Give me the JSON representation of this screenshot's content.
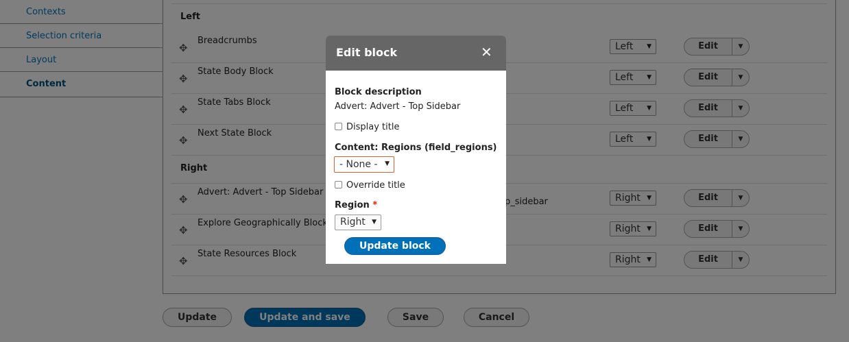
{
  "vertical_tabs": [
    {
      "label": "Contexts"
    },
    {
      "label": "Selection criteria"
    },
    {
      "label": "Layout"
    },
    {
      "label": "Content",
      "active": true
    }
  ],
  "regions": {
    "left": {
      "heading": "Left",
      "rows": [
        {
          "title": "Breadcrumbs",
          "region": "Left",
          "edit": "Edit"
        },
        {
          "title": "State Body Block",
          "region": "Left",
          "edit": "Edit"
        },
        {
          "title": "State Tabs Block",
          "region": "Left",
          "edit": "Edit"
        },
        {
          "title": "Next State Block",
          "region": "Left",
          "edit": "Edit"
        }
      ]
    },
    "right": {
      "heading": "Right",
      "rows": [
        {
          "title": "Advert: Advert - Top Sidebar",
          "extra": "op_sidebar",
          "region": "Right",
          "edit": "Edit"
        },
        {
          "title": "Explore Geographically Block",
          "region": "Right",
          "edit": "Edit"
        },
        {
          "title": "State Resources Block",
          "region": "Right",
          "edit": "Edit"
        }
      ]
    }
  },
  "footer_buttons": {
    "update": "Update",
    "update_and_save": "Update and save",
    "save": "Save",
    "cancel": "Cancel"
  },
  "dialog": {
    "title": "Edit block",
    "close_glyph": "✕",
    "block_description_label": "Block description",
    "block_description_value": "Advert: Advert - Top Sidebar",
    "display_title_label": "Display title",
    "display_title_checked": false,
    "content_regions_label": "Content: Regions (field_regions)",
    "content_regions_value": "- None -",
    "override_title_label": "Override title",
    "override_title_checked": false,
    "region_label": "Region",
    "region_required_marker": "*",
    "region_value": "Right",
    "update_button": "Update block"
  },
  "icons": {
    "drag_handle": "drag-handle-icon",
    "dropdown_arrow": "chevron-down-icon",
    "close": "close-icon"
  },
  "colors": {
    "link": "#0074bd",
    "primary_button": "#0071b8",
    "dialog_header": "#666666",
    "required": "#e62600",
    "error_border": "#e05d2f"
  }
}
